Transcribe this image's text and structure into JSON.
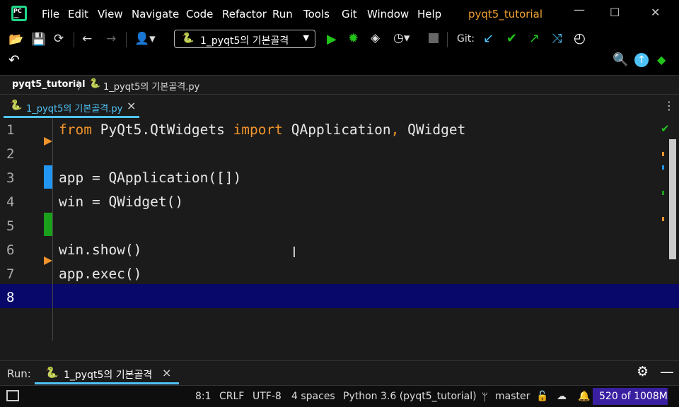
{
  "app": {
    "icon": "pycharm-icon",
    "title": "pyqt5_tutorial"
  },
  "menu": [
    "File",
    "Edit",
    "View",
    "Navigate",
    "Code",
    "Refactor",
    "Run",
    "Tools",
    "Git",
    "Window",
    "Help"
  ],
  "toolbar": {
    "run_config": "1_pyqt5의 기본골격",
    "git_label": "Git:"
  },
  "breadcrumb": {
    "project": "pyqt5_tutorial",
    "file": "1_pyqt5의 기본골격.py"
  },
  "tab": {
    "label": "1_pyqt5의 기본골격.py",
    "close": "×"
  },
  "editor": {
    "line_numbers": [
      "1",
      "2",
      "3",
      "4",
      "5",
      "6",
      "7",
      "8"
    ],
    "lines": [
      {
        "kw1": "from",
        "t1": " PyQt5.QtWidgets ",
        "kw2": "import",
        "t2": " QApplication",
        "kw3": ",",
        "t3": " QWidget"
      },
      {},
      {
        "t1": "app = QApplication([])"
      },
      {
        "t1": "win = QWidget()"
      },
      {},
      {
        "t1": "win.show()"
      },
      {
        "t1": "app.exec()"
      },
      {}
    ],
    "check_mark": "✔"
  },
  "run_panel": {
    "label": "Run:",
    "tab": "1_pyqt5의 기본골격",
    "close": "×"
  },
  "status": {
    "position": "8:1",
    "line_sep": "CRLF",
    "encoding": "UTF-8",
    "indent": "4 spaces",
    "interpreter": "Python 3.6 (pyqt5_tutorial)",
    "branch": "master",
    "memory": "520 of 1008M"
  },
  "colors": {
    "accent": "#4fc3f7",
    "keyword": "#f0932b",
    "current_line": "#08086a",
    "run_green": "#22c41a"
  }
}
